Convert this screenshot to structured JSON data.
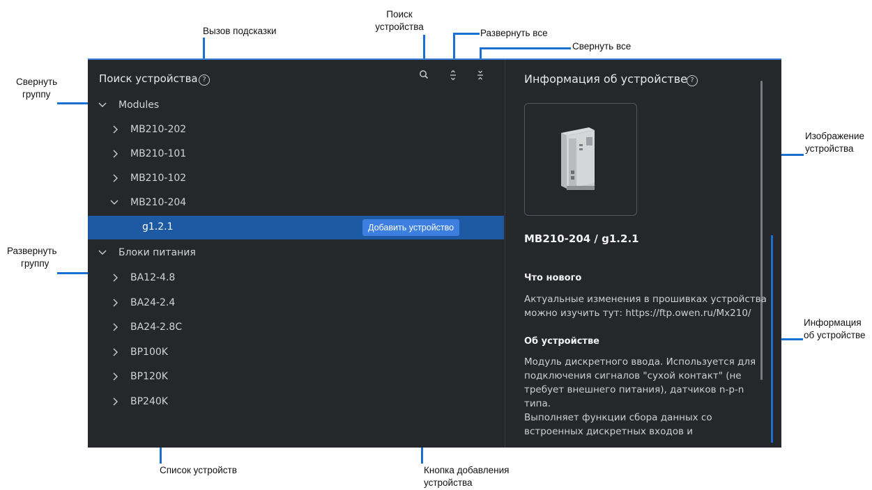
{
  "callouts": {
    "hint": "Вызов подсказки",
    "search_line1": "Поиск",
    "search_line2": "устройства",
    "expand_all": "Развернуть все",
    "collapse_all": "Свернуть все",
    "collapse_group_line1": "Свернуть",
    "collapse_group_line2": "группу",
    "expand_group_line1": "Развернуть",
    "expand_group_line2": "группу",
    "device_image_line1": "Изображение",
    "device_image_line2": "устройства",
    "device_info_line1": "Информация",
    "device_info_line2": "об устройстве",
    "device_list": "Список устройств",
    "add_button_line1": "Кнопка добавления",
    "add_button_line2": "устройства"
  },
  "left_panel": {
    "title": "Поиск устройства",
    "help_icon": "question-circle-icon",
    "tools": [
      "search-icon",
      "expand-all-icon",
      "collapse-all-icon"
    ],
    "tree": [
      {
        "label": "Modules",
        "level": 0,
        "expanded": true
      },
      {
        "label": "MB210-202",
        "level": 1,
        "expanded": false
      },
      {
        "label": "MB210-101",
        "level": 1,
        "expanded": false
      },
      {
        "label": "MB210-102",
        "level": 1,
        "expanded": false
      },
      {
        "label": "MB210-204",
        "level": 1,
        "expanded": true
      },
      {
        "label": "g1.2.1",
        "level": 2,
        "selected": true
      },
      {
        "label": "Блоки питания",
        "level": 0,
        "expanded": true
      },
      {
        "label": "BA12-4.8",
        "level": 1,
        "expanded": false
      },
      {
        "label": "BA24-2.4",
        "level": 1,
        "expanded": false
      },
      {
        "label": "BA24-2.8C",
        "level": 1,
        "expanded": false
      },
      {
        "label": "BP100K",
        "level": 1,
        "expanded": false
      },
      {
        "label": "BP120K",
        "level": 1,
        "expanded": false
      },
      {
        "label": "BP240K",
        "level": 1,
        "expanded": false
      }
    ],
    "add_button": "Добавить устройство"
  },
  "right_panel": {
    "title": "Информация об устройстве",
    "device_name": "MB210-204 / g1.2.1",
    "whats_new_title": "Что нового",
    "whats_new_text": "Актуальные изменения в прошивках устройства\nможно изучить тут: https://ftp.owen.ru/Mx210/",
    "about_title": "Об устройстве",
    "about_text": "Модуль дискретного ввода. Используется для\nподключения сигналов \"сухой контакт\" (не\nтребует внешнего питания), датчиков n-p-n\nтипа.\nВыполняет функции сбора данных со\nвстроенных дискретных входов и"
  },
  "colors": {
    "panel_bg": "#26272b",
    "selected_row": "#1d5aa3",
    "button": "#3d7fe0",
    "callout_line": "#1a6fd1"
  }
}
